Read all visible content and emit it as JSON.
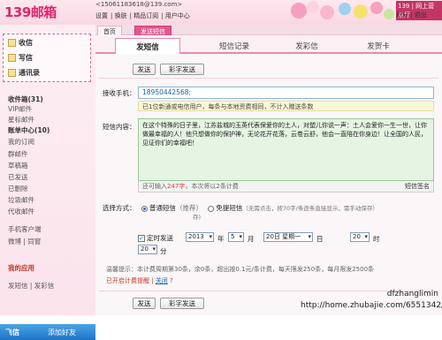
{
  "header": {
    "logo": "139邮箱",
    "account": "<15061183618@139.com>",
    "nav": [
      "设置",
      "换肤",
      "精品订阅",
      "用户中心"
    ],
    "top_links": [
      "139 | 网上营业厅",
      "积分 | 退出"
    ]
  },
  "sidebar": {
    "quick": [
      "收信",
      "写信",
      "通讯录"
    ],
    "items": [
      {
        "label": "收件箱(31)",
        "bold": true
      },
      {
        "label": "VIP邮件",
        "bold": false
      },
      {
        "label": "星标邮件",
        "bold": false
      },
      {
        "label": "账单中心(10)",
        "bold": true
      },
      {
        "label": "我的订阅",
        "bold": false
      },
      {
        "label": "群邮件",
        "bold": false
      },
      {
        "label": "草稿箱",
        "bold": false
      },
      {
        "label": "已发送",
        "bold": false
      },
      {
        "label": "已删除",
        "bold": false
      },
      {
        "label": "垃圾邮件",
        "bold": false
      },
      {
        "label": "代收邮件",
        "bold": false
      },
      {
        "label": "手机客户端",
        "bold": false
      },
      {
        "label": "微博 | 同窗",
        "bold": false
      },
      {
        "label": "我的应用",
        "bold": true
      },
      {
        "label": "发短信 | 发彩信",
        "bold": false
      }
    ],
    "feixin": "飞信",
    "feixin_action": "添加好友"
  },
  "tabs": {
    "page_tabs": [
      "首页",
      "发送短信"
    ],
    "sms_tabs": [
      "发短信",
      "短信记录",
      "发彩信",
      "发贺卡"
    ],
    "active": 0
  },
  "toolbar": {
    "send": "发送",
    "color_send": "彩字发送"
  },
  "form": {
    "to_label": "接收手机：",
    "to_value": "18950442568;",
    "notice": "已1位新通或电信用户，每条与本地资费相同，不计入赠送条数",
    "content_label": "短信内容：",
    "content": "在这个特殊的日子里，江苏盐城的玉英代表保爱你的土人，对塑儿你说一声：土人会爱你一生一世，让你做最幸福的人！他只想做你的保护神，无论花开花落，云卷云舒，他会一直陪在你身边！让全国的人民，见证你们的幸福吧！",
    "counter_prefix": "还可输入",
    "counter_value": "247字",
    "counter_suffix": "，本次将以2条计费",
    "signature": "短信签名",
    "method_label": "选择方式：",
    "method_normal": "普通短信",
    "method_normal_note": "（推荐）",
    "method_free": "免提短信",
    "method_free_note": "（无需点击，按70字/条逐条直接显示，需手动保存）",
    "timed_label": "定时发送",
    "year": "2013",
    "year_unit": "年",
    "month": "5",
    "month_unit": "月",
    "day": "20日 星期一",
    "day_unit": "日",
    "hour": "20",
    "hour_unit": "时",
    "minute": "20",
    "minute_unit": "分",
    "info": "温馨提示：本计费周期第30条，余0条，超出按0.1元/条计费，每天限发250条，每月限发2500条",
    "footer_status": "已开启计费提醒",
    "footer_close": "关闭",
    "footer_help": "?"
  },
  "watermark": [
    "dfzhanglimin",
    "http://home.zhubajie.com/6551342/"
  ]
}
